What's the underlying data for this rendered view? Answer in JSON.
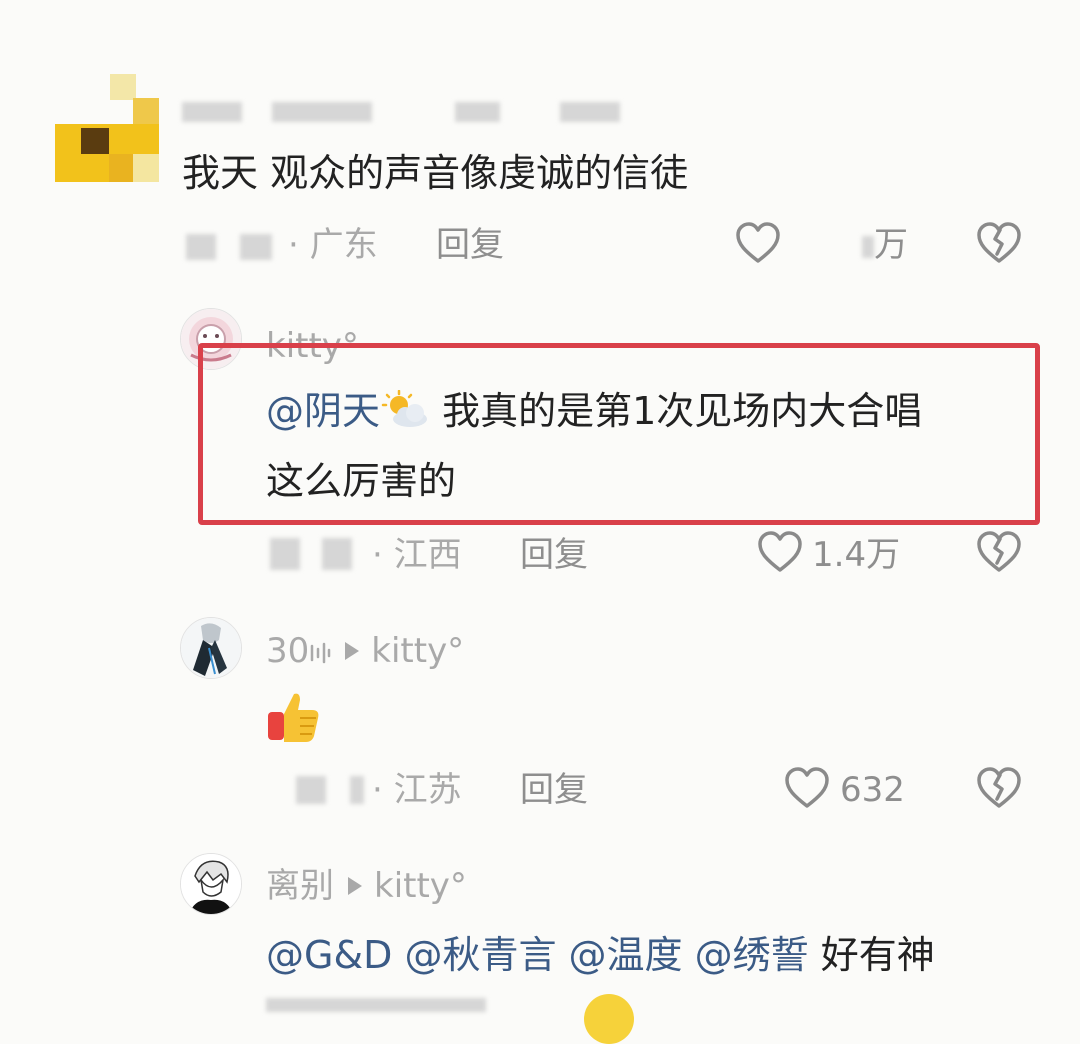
{
  "comments": [
    {
      "text": "我天 观众的声音像虔诚的信徒",
      "location": "· 广东",
      "reply_label": "回复",
      "likes": "万"
    },
    {
      "username": "kitty°",
      "mention": "@阴天",
      "text_line1": " 我真的是第1次见场内大合唱",
      "text_line2": "这么厉害的",
      "location": "· 江西",
      "reply_label": "回复",
      "likes": "1.4万"
    },
    {
      "username": "30",
      "reply_to": "kitty°",
      "emoji": "thumbs-up",
      "location": "· 江苏",
      "reply_label": "回复",
      "likes": "632"
    },
    {
      "username": "离别",
      "reply_to": "kitty°",
      "mentions": [
        "@G&D",
        "@秋青言",
        "@温度",
        "@绣誓"
      ],
      "text": " 好有神"
    }
  ],
  "colors": {
    "background": "#fbfbf9",
    "mention": "#3b5b86",
    "highlight_border": "#d9404a",
    "muted_text": "#a9a9a9"
  },
  "icons": [
    "heart-icon",
    "broken-heart-icon",
    "weather-partly-cloudy-icon",
    "thumbs-up-emoji-icon",
    "play-arrow-icon",
    "audio-wave-icon"
  ]
}
